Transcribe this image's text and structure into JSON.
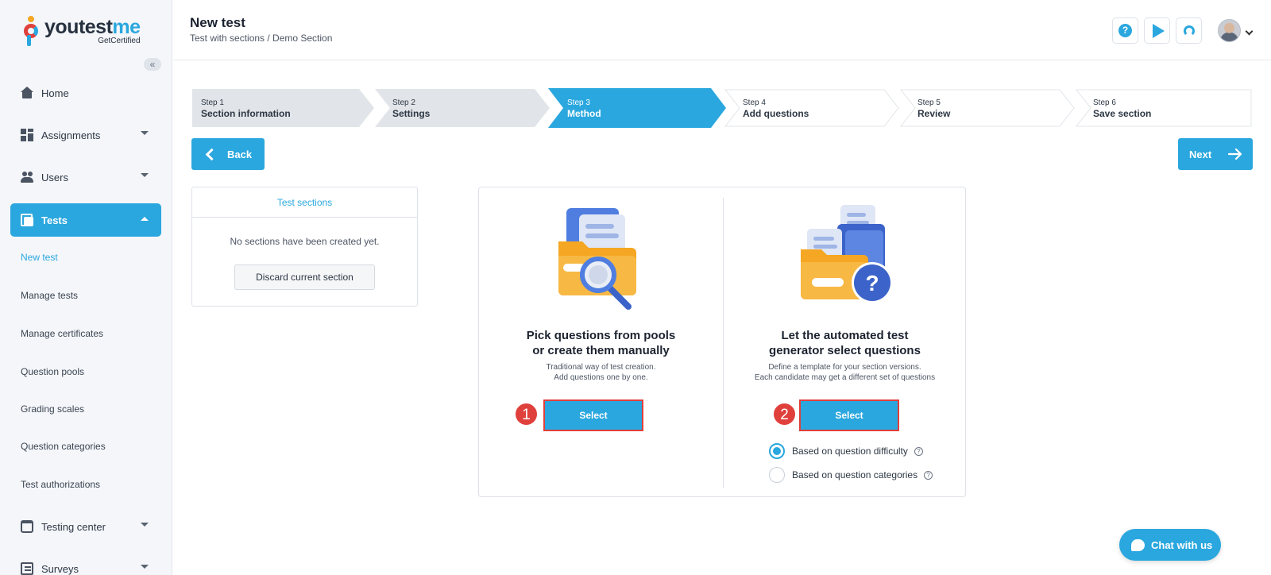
{
  "brand": {
    "name_main": "youtest",
    "name_accent": "me",
    "tagline": "GetCertified"
  },
  "header": {
    "title": "New test",
    "breadcrumb": "Test with sections / Demo Section"
  },
  "sidebar": {
    "collapse_glyph": "«",
    "items": [
      {
        "label": "Home",
        "icon": "home-icon"
      },
      {
        "label": "Assignments",
        "icon": "grid-icon"
      },
      {
        "label": "Users",
        "icon": "users-icon"
      },
      {
        "label": "Tests",
        "icon": "tests-icon"
      }
    ],
    "sub_items": [
      "New test",
      "Manage tests",
      "Manage certificates",
      "Question pools",
      "Grading scales",
      "Question categories",
      "Test authorizations"
    ],
    "bottom_items": [
      {
        "label": "Testing center",
        "icon": "calendar-icon"
      },
      {
        "label": "Surveys",
        "icon": "list-icon"
      }
    ]
  },
  "stepper": [
    {
      "num": "Step 1",
      "label": "Section information",
      "state": "done"
    },
    {
      "num": "Step 2",
      "label": "Settings",
      "state": "done"
    },
    {
      "num": "Step 3",
      "label": "Method",
      "state": "active"
    },
    {
      "num": "Step 4",
      "label": "Add questions",
      "state": "todo"
    },
    {
      "num": "Step 5",
      "label": "Review",
      "state": "todo"
    },
    {
      "num": "Step 6",
      "label": "Save section",
      "state": "todo"
    }
  ],
  "nav_buttons": {
    "back": "Back",
    "next": "Next"
  },
  "sections_panel": {
    "title": "Test sections",
    "empty_text": "No sections have been created yet.",
    "discard_label": "Discard current section"
  },
  "methods": {
    "manual": {
      "title_line1": "Pick questions from pools",
      "title_line2": "or create them manually",
      "desc_line1": "Traditional way of test creation.",
      "desc_line2": "Add questions one by one.",
      "select_label": "Select",
      "marker": "1"
    },
    "auto": {
      "title_line1": "Let the automated test",
      "title_line2": "generator select questions",
      "desc_line1": "Define a template for your section versions.",
      "desc_line2": "Each candidate may get a different set of questions",
      "select_label": "Select",
      "marker": "2",
      "options": [
        {
          "label": "Based on question difficulty",
          "selected": true
        },
        {
          "label": "Based on question categories",
          "selected": false
        }
      ]
    }
  },
  "chat": {
    "label": "Chat with us"
  },
  "colors": {
    "accent": "#2aa7de",
    "highlight": "#e0403c",
    "step_done": "#e1e4e8"
  }
}
